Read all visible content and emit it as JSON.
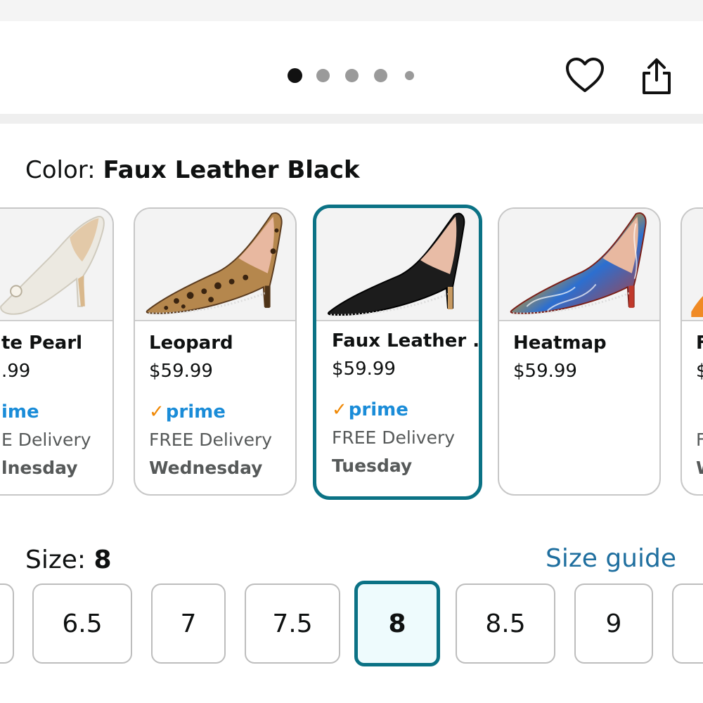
{
  "gallery": {
    "dots": [
      {
        "active": true
      },
      {
        "active": false
      },
      {
        "active": false
      },
      {
        "active": false
      },
      {
        "active": false
      }
    ],
    "icons": {
      "favorite": "heart-outline-icon",
      "share": "share-icon"
    }
  },
  "color": {
    "label": "Color:",
    "selected": "Faux Leather Black",
    "options": [
      {
        "name": "te Pearl",
        "price": ".99",
        "prime": "ime",
        "delivery": "E Delivery",
        "day": "lnesday"
      },
      {
        "name": "Leopard",
        "price": "$59.99",
        "prime": "prime",
        "delivery": "FREE Delivery",
        "day": "Wednesday"
      },
      {
        "name": "Faux Leather ...",
        "price": "$59.99",
        "prime": "prime",
        "delivery": "FREE Delivery",
        "day": "Tuesday"
      },
      {
        "name": "Heatmap",
        "price": "$59.99"
      },
      {
        "name": "F",
        "price": "$",
        "delivery": "F",
        "day": "W"
      }
    ]
  },
  "size": {
    "label": "Size:",
    "selected": "8",
    "guide": "Size guide",
    "options": [
      "6.5",
      "7",
      "7.5",
      "8",
      "8.5",
      "9"
    ]
  },
  "colors": {
    "accent": "#0b7285",
    "prime_blue": "#1a8cd8",
    "prime_check": "#f08804",
    "link": "#1f6f9f"
  }
}
